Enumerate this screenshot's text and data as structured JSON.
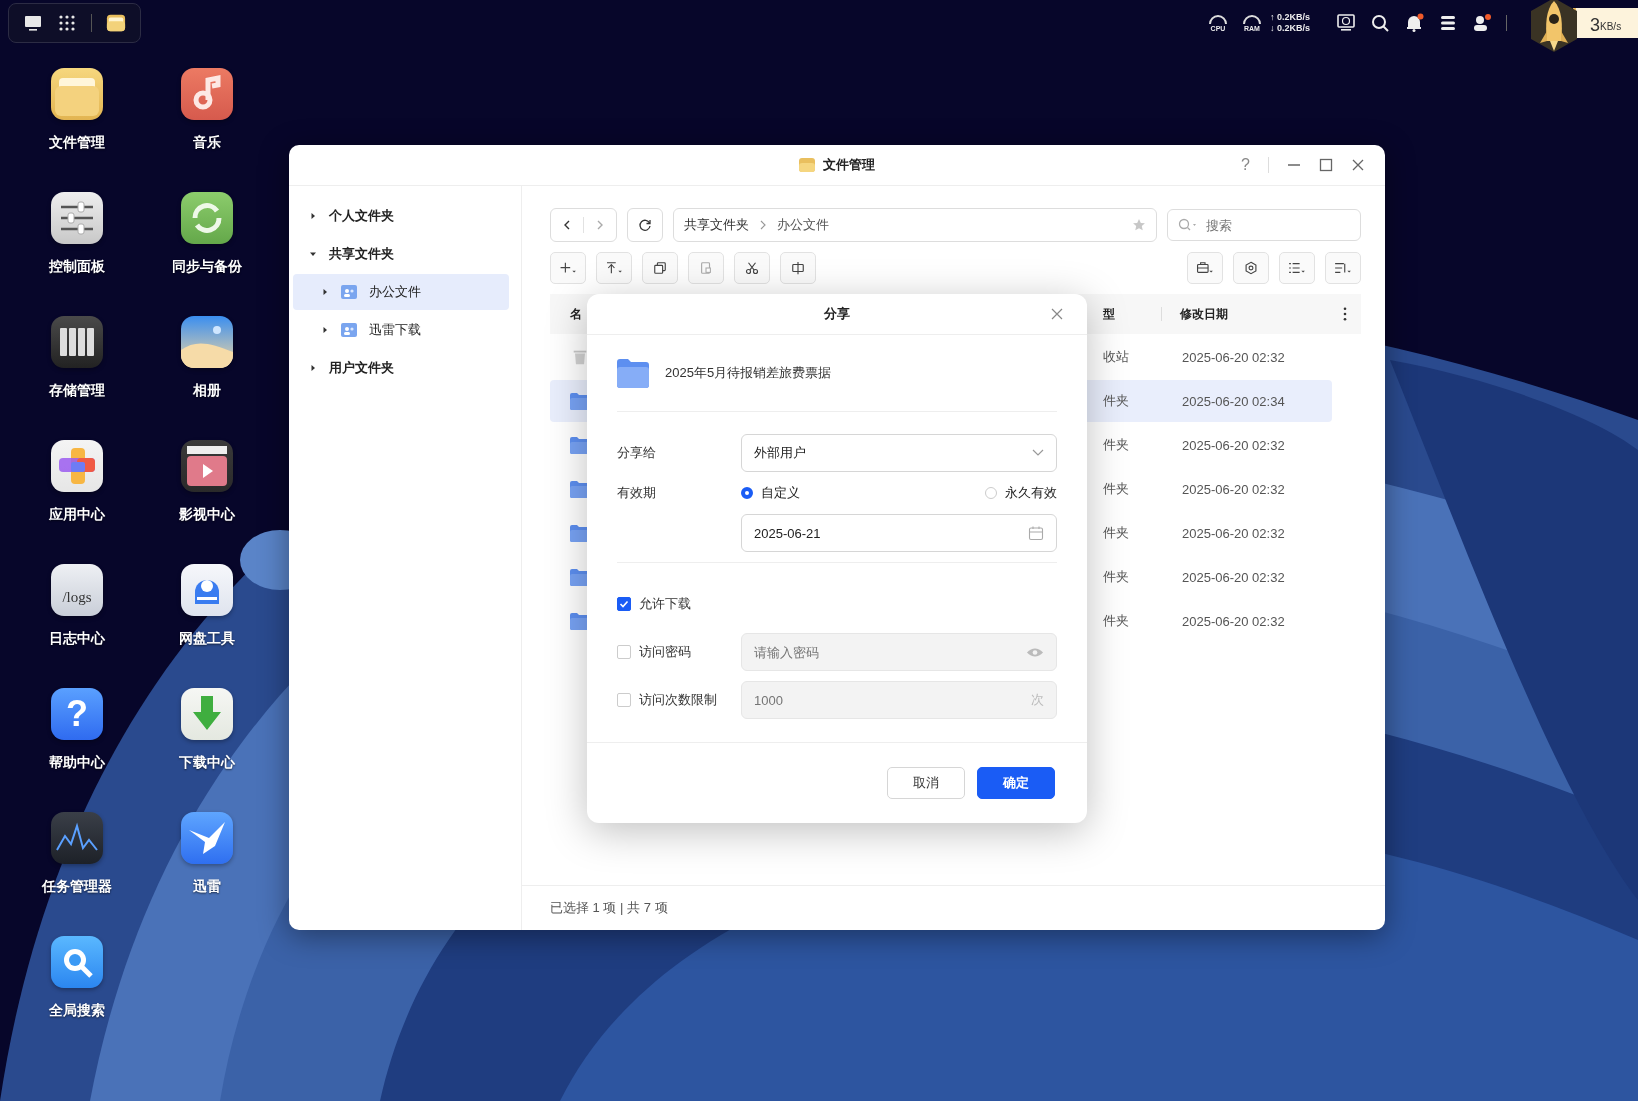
{
  "topbar": {
    "cpu_label": "CPU",
    "ram_label": "RAM",
    "upload": "↑ 0.2KB/s",
    "download": "↓ 0.2KB/s",
    "bell_alert": true,
    "user_alert": true,
    "speed_value": "3",
    "speed_unit": "KB/s"
  },
  "desktop_icons": [
    {
      "label": "文件管理",
      "kind": "files"
    },
    {
      "label": "音乐",
      "kind": "music"
    },
    {
      "label": "控制面板",
      "kind": "control"
    },
    {
      "label": "同步与备份",
      "kind": "sync"
    },
    {
      "label": "存储管理",
      "kind": "storage"
    },
    {
      "label": "相册",
      "kind": "photos"
    },
    {
      "label": "应用中心",
      "kind": "apps"
    },
    {
      "label": "影视中心",
      "kind": "video"
    },
    {
      "label": "日志中心",
      "kind": "logs",
      "glyph": "/logs"
    },
    {
      "label": "网盘工具",
      "kind": "cloud"
    },
    {
      "label": "帮助中心",
      "kind": "help",
      "glyph": "?"
    },
    {
      "label": "下载中心",
      "kind": "download"
    },
    {
      "label": "任务管理器",
      "kind": "tasks"
    },
    {
      "label": "迅雷",
      "kind": "bird"
    },
    {
      "label": "全局搜索",
      "kind": "search"
    }
  ],
  "window": {
    "title": "文件管理",
    "help": "?"
  },
  "sidebar": {
    "items": [
      {
        "label": "个人文件夹",
        "expanded": false,
        "selected": false
      },
      {
        "label": "共享文件夹",
        "expanded": true,
        "selected": false,
        "children": [
          {
            "label": "办公文件",
            "expanded": false,
            "selected": true
          },
          {
            "label": "迅雷下载",
            "expanded": false,
            "selected": false
          }
        ]
      },
      {
        "label": "用户文件夹",
        "expanded": false,
        "selected": false
      }
    ]
  },
  "path": [
    "共享文件夹",
    "办公文件"
  ],
  "search": {
    "placeholder": "搜索"
  },
  "table": {
    "columns": [
      "名",
      "型",
      "修改日期"
    ],
    "rows": [
      {
        "kind": "trash",
        "type": "收站",
        "modified": "2025-06-20 02:32",
        "selected": false
      },
      {
        "kind": "folder",
        "type": "件夹",
        "modified": "2025-06-20 02:34",
        "selected": true
      },
      {
        "kind": "folder",
        "type": "件夹",
        "modified": "2025-06-20 02:32",
        "selected": false
      },
      {
        "kind": "folder",
        "type": "件夹",
        "modified": "2025-06-20 02:32",
        "selected": false
      },
      {
        "kind": "folder",
        "type": "件夹",
        "modified": "2025-06-20 02:32",
        "selected": false
      },
      {
        "kind": "folder",
        "type": "件夹",
        "modified": "2025-06-20 02:32",
        "selected": false
      },
      {
        "kind": "folder",
        "type": "件夹",
        "modified": "2025-06-20 02:32",
        "selected": false
      }
    ]
  },
  "status_bar": "已选择 1 项 | 共 7 项",
  "dialog": {
    "title": "分享",
    "item_name": "2025年5月待报销差旅费票据",
    "share_to": {
      "label": "分享给",
      "value": "外部用户"
    },
    "validity": {
      "label": "有效期",
      "options": [
        {
          "label": "自定义",
          "selected": true
        },
        {
          "label": "永久有效",
          "selected": false
        }
      ],
      "date": "2025-06-21"
    },
    "allow_download": {
      "label": "允许下载",
      "checked": true
    },
    "password": {
      "label": "访问密码",
      "checked": false,
      "placeholder": "请输入密码",
      "disabled": true
    },
    "visit_limit": {
      "label": "访问次数限制",
      "checked": false,
      "placeholder": "1000",
      "unit": "次",
      "disabled": true
    },
    "buttons": [
      {
        "label": "取消",
        "kind": "secondary"
      },
      {
        "label": "确定",
        "kind": "primary"
      }
    ]
  }
}
